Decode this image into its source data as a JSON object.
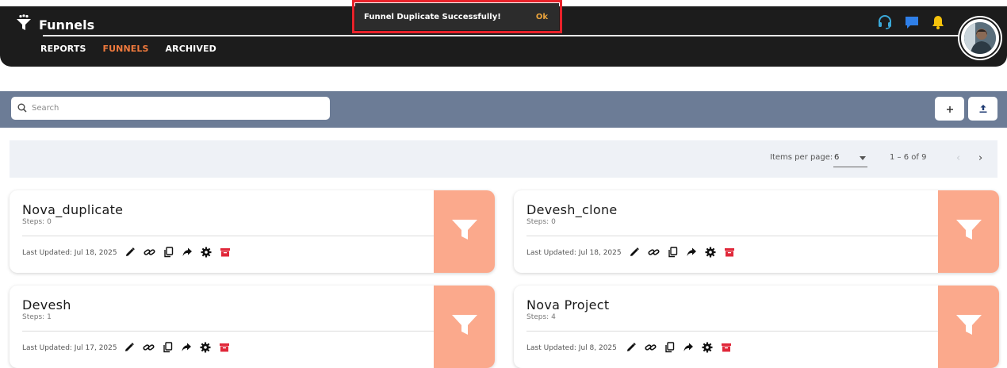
{
  "app": {
    "title": "Funnels",
    "nav": [
      {
        "label": "REPORTS",
        "active": false
      },
      {
        "label": "FUNNELS",
        "active": true
      },
      {
        "label": "ARCHIVED",
        "active": false
      }
    ],
    "icons": [
      "headset-icon",
      "chat-icon",
      "bell-icon"
    ]
  },
  "toast": {
    "message": "Funnel Duplicate Successfully!",
    "action": "Ok"
  },
  "search": {
    "placeholder": "Search",
    "value": ""
  },
  "toolbar": {
    "add_icon": "plus-icon",
    "upload_icon": "upload-icon"
  },
  "paginator": {
    "label": "Items per page:",
    "page_size": "6",
    "range": "1 – 6 of 9"
  },
  "funnels": [
    {
      "name": "Nova_duplicate",
      "steps": "Steps: 0",
      "updated": "Last Updated: Jul 18, 2025"
    },
    {
      "name": "Devesh_clone",
      "steps": "Steps: 0",
      "updated": "Last Updated: Jul 18, 2025"
    },
    {
      "name": "Devesh",
      "steps": "Steps: 1",
      "updated": "Last Updated: Jul 17, 2025"
    },
    {
      "name": "Nova Project",
      "steps": "Steps: 4",
      "updated": "Last Updated: Jul 8, 2025"
    }
  ],
  "colors": {
    "navbar": "#1c1c1c",
    "accent": "#f17a3d",
    "toast_outline": "#e8222a",
    "toast_action": "#e9a23b",
    "toolbar": "#6c7c96",
    "thumb": "#fba98c",
    "archive": "#e0283a",
    "chat": "#2f7fe8",
    "bell": "#f5c20b",
    "headset": "#3aa8d8"
  },
  "card_actions": [
    "edit-icon",
    "link-icon",
    "copy-icon",
    "share-icon",
    "settings-icon",
    "archive-icon"
  ]
}
